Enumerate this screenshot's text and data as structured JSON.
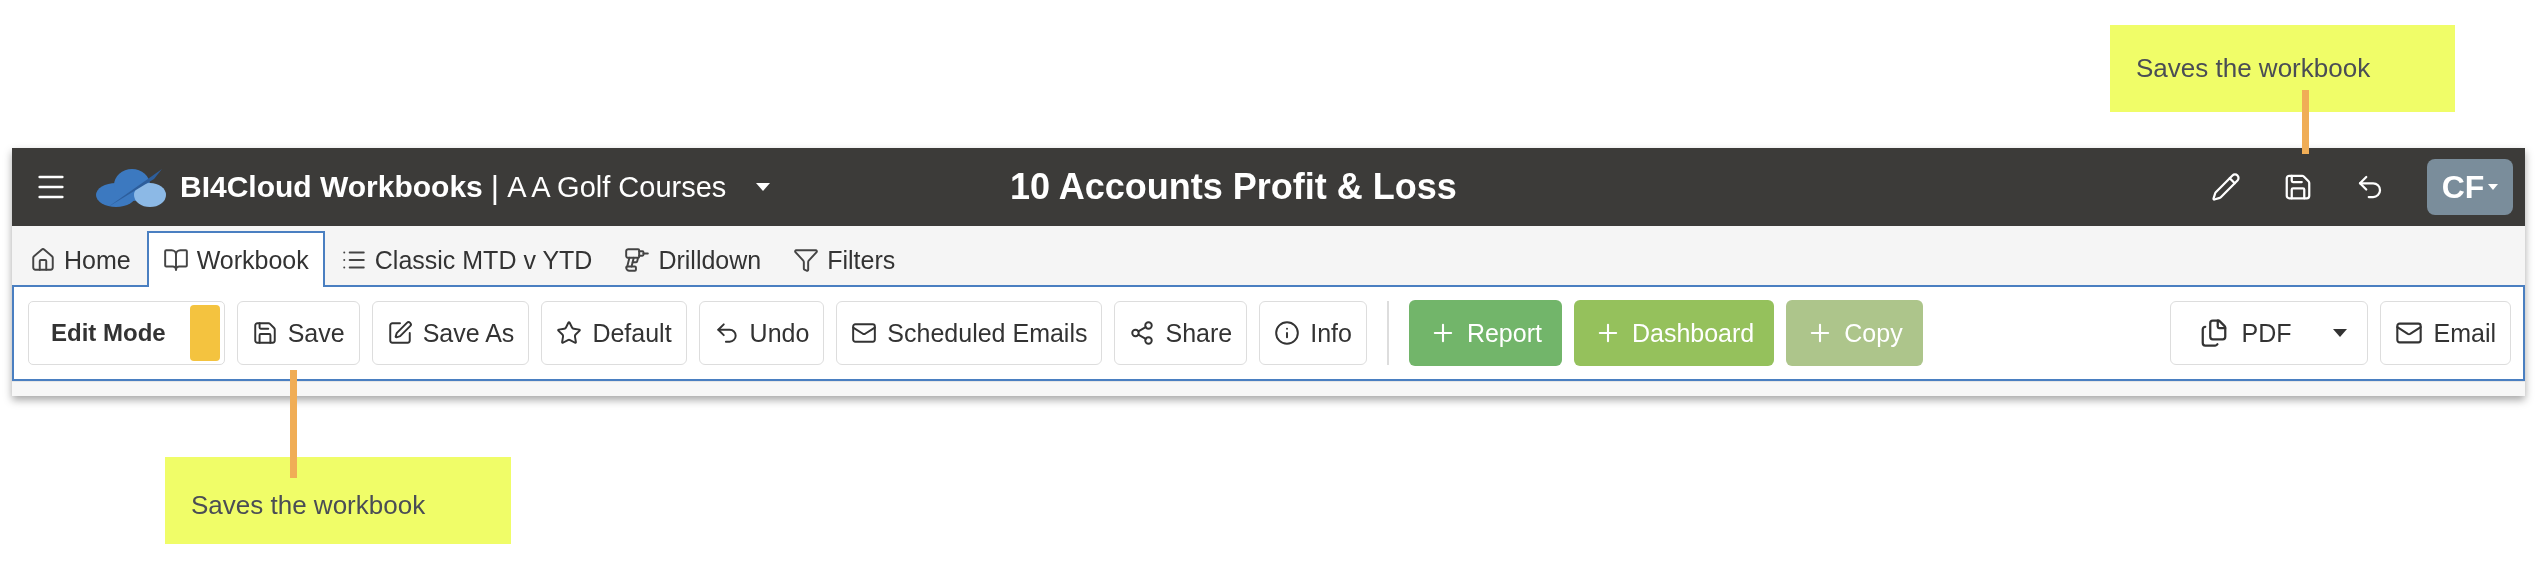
{
  "callouts": [
    {
      "text": "Saves the workbook"
    },
    {
      "text": "Saves the workbook"
    }
  ],
  "header": {
    "brand": "BI4Cloud Workbooks",
    "separator": "|",
    "company": "A A Golf Courses",
    "title": "10 Accounts Profit & Loss",
    "avatar": "CF"
  },
  "tabs": [
    {
      "label": "Home",
      "selected": false
    },
    {
      "label": "Workbook",
      "selected": true
    },
    {
      "label": "Classic MTD v YTD",
      "selected": false
    },
    {
      "label": "Drilldown",
      "selected": false
    },
    {
      "label": "Filters",
      "selected": false
    }
  ],
  "edit_mode": {
    "label": "Edit Mode",
    "on": true
  },
  "buttons": [
    {
      "label": "Save",
      "kind": "outline"
    },
    {
      "label": "Save As",
      "kind": "outline"
    },
    {
      "label": "Default",
      "kind": "outline"
    },
    {
      "label": "Undo",
      "kind": "outline"
    },
    {
      "label": "Scheduled Emails",
      "kind": "outline"
    },
    {
      "label": "Share",
      "kind": "outline"
    },
    {
      "label": "Info",
      "kind": "outline"
    },
    {
      "label": "Report",
      "kind": "add",
      "color": "#72b56a"
    },
    {
      "label": "Dashboard",
      "kind": "add",
      "color": "#95c15c"
    },
    {
      "label": "Copy",
      "kind": "add",
      "color": "#adc58b"
    }
  ],
  "export_buttons": [
    {
      "label": "PDF",
      "kind": "dropdown"
    },
    {
      "label": "Email",
      "kind": "plain"
    }
  ]
}
